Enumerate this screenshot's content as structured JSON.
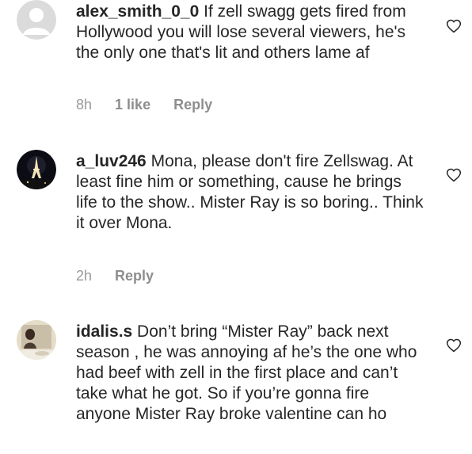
{
  "comments": [
    {
      "username": "alex_smith_0_0",
      "text": "If zell swagg gets fired from Hollywood you will lose several viewers, he's the only one that's lit and others lame af",
      "time": "8h",
      "likes": "1 like",
      "reply": "Reply",
      "avatar": "default-avatar"
    },
    {
      "username": "a_luv246",
      "text": "Mona, please don't fire Zellswag.  At least fine him or something, cause he brings life to the show.. Mister Ray is so boring.. Think it over Mona.",
      "time": "2h",
      "reply": "Reply",
      "avatar": "eiffel-tower-night"
    },
    {
      "username": "idalis.s",
      "text": "Don’t bring “Mister Ray” back next season , he was annoying af he’s the one who had beef with zell in the first place and can’t take what he got. So if you’re gonna fire anyone Mister Ray broke valentine can ho",
      "avatar": "mirror-selfie"
    }
  ],
  "icons": {
    "like": "heart-outline-icon"
  }
}
